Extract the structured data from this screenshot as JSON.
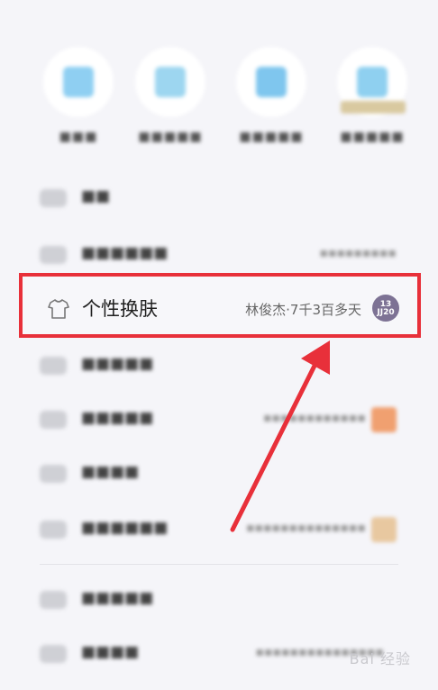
{
  "colors": {
    "highlight_border": "#e8303a",
    "page_bg": "#f5f5f9",
    "arrow": "#e8303a"
  },
  "highlighted_item": {
    "icon": "tshirt-icon",
    "title": "个性换肤",
    "subtitle": "林俊杰·7千3百多天",
    "avatar_text_top": "13",
    "avatar_text_bottom": "JJ20"
  },
  "watermark": "Bai 经验"
}
